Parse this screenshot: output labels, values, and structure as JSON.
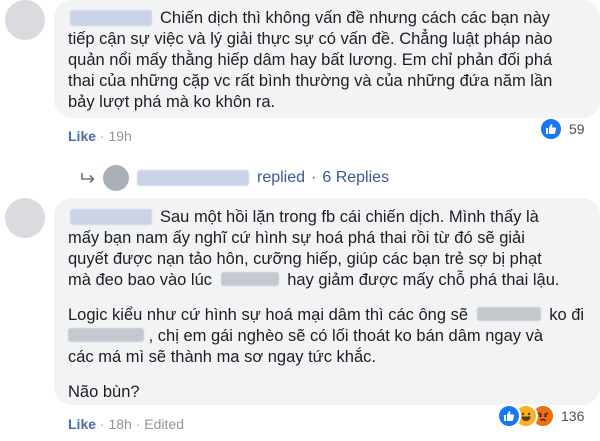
{
  "comment1": {
    "lines": [
      "Chiến dịch thì không vấn đề nhưng cách các bạn này",
      "tiếp cận sự việc và lý giải thực sự có vấn đề. Chẳng luật pháp nào",
      "quản nổi mấy thằng hiếp dâm hay bất lương. Em chỉ phản đối phá",
      "thai của những cặp vc rất bình thường và của những đứa năm lần",
      "bảy lượt phá mà ko khôn ra."
    ],
    "like_label": "Like",
    "time": "19h",
    "reaction_count": "59",
    "reply_icon": "arrow-reply-icon",
    "replied_label": "replied",
    "replies_count": "6 Replies"
  },
  "comment2": {
    "para1_lines": [
      "Sau một hồi lặn trong fb cái chiến dịch. Mình thấy là",
      "mấy bạn nam ấy nghĩ cứ hình sự hoá phá thai rồi từ đó sẽ giải",
      "quyết được nạn tảo hôn, cưỡng hiếp, giúp các bạn trẻ sợ bị phạt"
    ],
    "p1l4_a": "mà đeo bao vào lúc",
    "p1l4_b": "hay giảm được mấy chỗ phá thai lậu.",
    "p2l1_a": "Logic kiểu như cứ hình sự hoá mại dâm thì các ông sẽ",
    "p2l1_b": "ko đi",
    "p2l2_b": ", chị em gái nghèo sẽ có lối thoát ko bán dâm ngay và",
    "p2l3": "các má mì sẽ thành ma sơ ngay tức khắc.",
    "p3": "Não bùn?",
    "like_label": "Like",
    "time": "18h",
    "edited": "Edited",
    "reaction_count": "136"
  },
  "icons": {
    "like": "like-icon",
    "haha": "haha-icon",
    "angry": "angry-icon"
  },
  "colors": {
    "bubble": "#f2f3f5",
    "link": "#385898",
    "like_blue": "#1877f2"
  }
}
